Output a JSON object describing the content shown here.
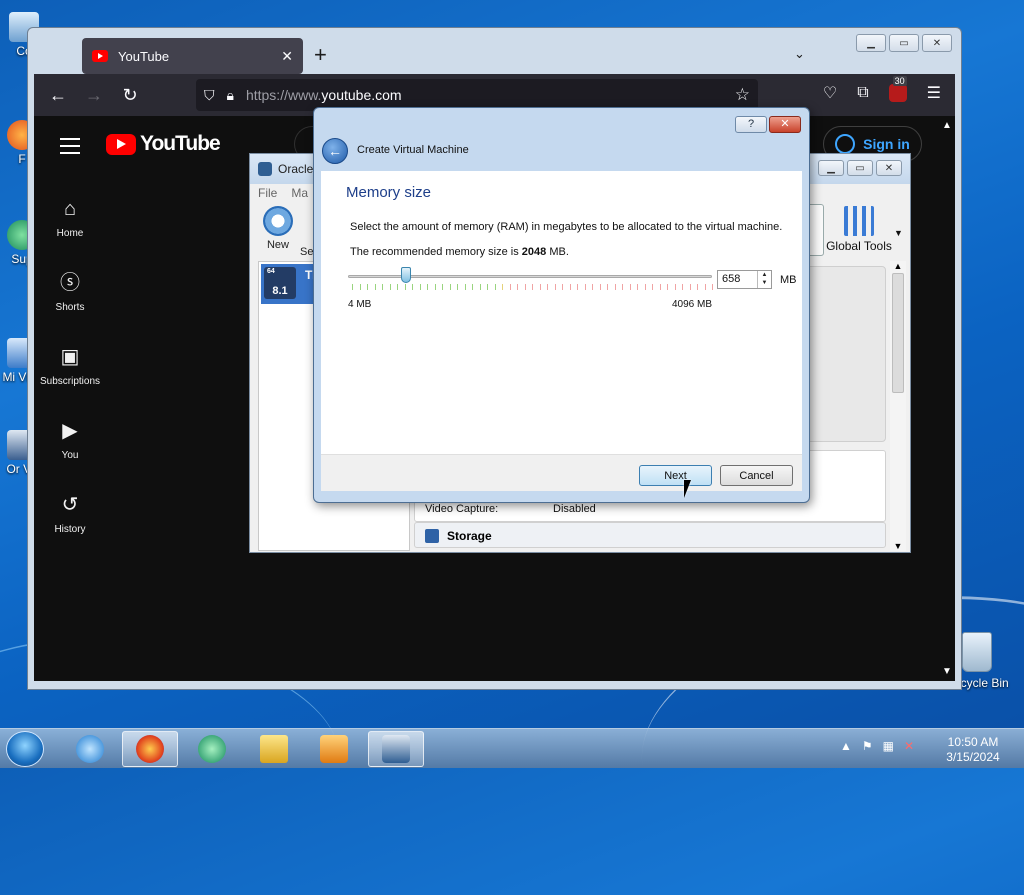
{
  "desktop": {
    "icons": [
      {
        "label": "Co"
      },
      {
        "label": "F"
      },
      {
        "label": "Sup"
      },
      {
        "label": "Mi Visu"
      },
      {
        "label": "Or Vir"
      }
    ],
    "recycle_bin": "Recycle Bin"
  },
  "firefox": {
    "tab_title": "YouTube",
    "url_protocol": "https://www.",
    "url_host": "youtube.com",
    "extension_badge": "30"
  },
  "youtube": {
    "logo_text": "YouTube",
    "sign_in": "Sign in",
    "sidebar": [
      {
        "label": "Home",
        "icon": "⌂"
      },
      {
        "label": "Shorts",
        "icon": "ⓢ"
      },
      {
        "label": "Subscriptions",
        "icon": "▣"
      },
      {
        "label": "You",
        "icon": "▶"
      },
      {
        "label": "History",
        "icon": "↺"
      }
    ]
  },
  "vbox_manager": {
    "title": "Oracle",
    "menu": [
      "File",
      "Ma"
    ],
    "new_label": "New",
    "se_label": "Se",
    "vm_badge": "8.1",
    "vm_badge_top": "64",
    "vm_name": "Ti",
    "global_tools": "Global Tools",
    "video_capture_label": "Video Capture:",
    "video_capture_value": "Disabled",
    "storage_heading": "Storage"
  },
  "dialog": {
    "window_title": "Create Virtual Machine",
    "heading": "Memory size",
    "description": "Select the amount of memory (RAM) in megabytes to be allocated to the virtual machine.",
    "recommended_prefix": "The recommended memory size is ",
    "recommended_value": "2048",
    "recommended_suffix": " MB.",
    "memory_value": "658",
    "unit": "MB",
    "min_label": "4 MB",
    "max_label": "4096 MB",
    "slider": {
      "min": 4,
      "max": 4096,
      "value": 658,
      "recommended": 2048
    },
    "help": "?",
    "next": "Next",
    "cancel": "Cancel"
  },
  "taskbar": {
    "time": "10:50 AM",
    "date": "3/15/2024"
  }
}
